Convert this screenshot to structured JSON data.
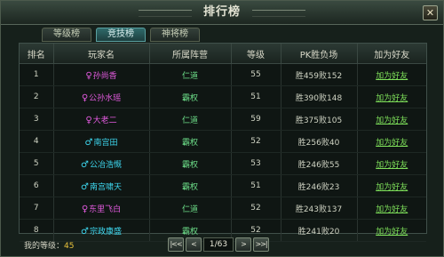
{
  "window": {
    "title": "排行榜",
    "close_icon": "close-icon"
  },
  "tabs": [
    "等级榜",
    "竞技榜",
    "神将榜"
  ],
  "active_tab": 1,
  "table": {
    "headers": [
      "排名",
      "玩家名",
      "所属阵营",
      "等级",
      "PK胜负场",
      "加为好友"
    ],
    "rows": [
      {
        "rank": "1",
        "gender": "female",
        "name": "孙尚香",
        "faction": "仁道",
        "level": "55",
        "record": "胜459败152",
        "action": "加为好友"
      },
      {
        "rank": "2",
        "gender": "female",
        "name": "公孙水瑶",
        "faction": "霸权",
        "level": "51",
        "record": "胜390败148",
        "action": "加为好友"
      },
      {
        "rank": "3",
        "gender": "female",
        "name": "大老二",
        "faction": "仁道",
        "level": "59",
        "record": "胜375败105",
        "action": "加为好友"
      },
      {
        "rank": "4",
        "gender": "male",
        "name": "南宫田",
        "faction": "霸权",
        "level": "52",
        "record": "胜256败40",
        "action": "加为好友"
      },
      {
        "rank": "5",
        "gender": "male",
        "name": "公冶浩慨",
        "faction": "霸权",
        "level": "53",
        "record": "胜246败55",
        "action": "加为好友"
      },
      {
        "rank": "6",
        "gender": "male",
        "name": "南宫啸天",
        "faction": "霸权",
        "level": "51",
        "record": "胜246败23",
        "action": "加为好友"
      },
      {
        "rank": "7",
        "gender": "female",
        "name": "东里飞白",
        "faction": "仁道",
        "level": "52",
        "record": "胜243败137",
        "action": "加为好友"
      },
      {
        "rank": "8",
        "gender": "male",
        "name": "宗政康盛",
        "faction": "霸权",
        "level": "52",
        "record": "胜241败20",
        "action": "加为好友"
      }
    ]
  },
  "footer": {
    "my_level_label": "我的等级：",
    "my_level_value": "45"
  },
  "pager": {
    "first": "|<<",
    "prev": "<",
    "page": "1/63",
    "next": ">",
    "last": ">>|"
  },
  "colors": {
    "female": "#e45be0",
    "male": "#3ed8f0",
    "faction": "#6ee08a",
    "link": "#7ee05a",
    "active_tab": "#2f6a6a"
  }
}
